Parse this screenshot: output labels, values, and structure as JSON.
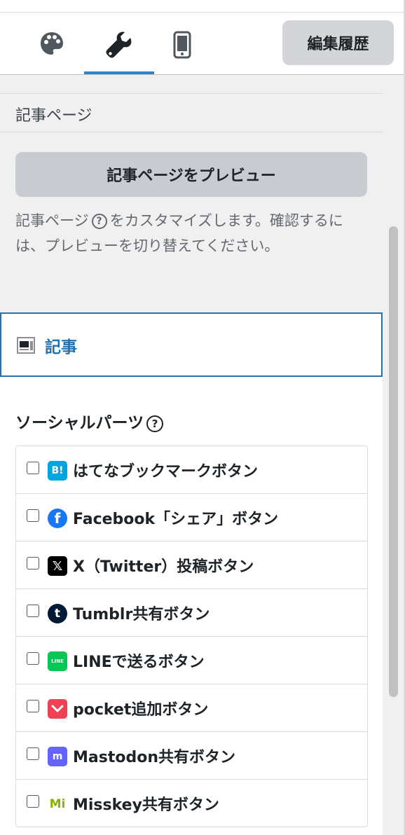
{
  "toolbar": {
    "tabs": [
      {
        "icon": "palette-icon"
      },
      {
        "icon": "wrench-icon",
        "active": true
      },
      {
        "icon": "smartphone-icon"
      }
    ],
    "history_label": "編集履歴"
  },
  "section": {
    "title": "記事ページ",
    "preview_label": "記事ページをプレビュー",
    "desc_before": "記事ページ",
    "desc_after": "をカスタマイズします。確認するには、プレビューを切り替えてください。",
    "help_glyph": "?"
  },
  "article": {
    "label": "記事"
  },
  "social": {
    "title": "ソーシャルパーツ",
    "help_glyph": "?",
    "items": [
      {
        "label": "はてなブックマークボタン",
        "icon": "hatena-bookmark-icon",
        "icon_text": "B!",
        "color": "#00a4de"
      },
      {
        "label": "Facebook「シェア」ボタン",
        "icon": "facebook-icon",
        "icon_text": "f",
        "color": "#1877f2"
      },
      {
        "label": "X（Twitter）投稿ボタン",
        "icon": "x-icon",
        "icon_text": "𝕏",
        "color": "#000000"
      },
      {
        "label": "Tumblr共有ボタン",
        "icon": "tumblr-icon",
        "icon_text": "t",
        "color": "#001935"
      },
      {
        "label": "LINEで送るボタン",
        "icon": "line-icon",
        "icon_text": "LINE",
        "color": "#06c755"
      },
      {
        "label": "pocket追加ボタン",
        "icon": "pocket-icon",
        "icon_text": "",
        "color": "#ef4056"
      },
      {
        "label": "Mastodon共有ボタン",
        "icon": "mastodon-icon",
        "icon_text": "m",
        "color": "#6364ff"
      },
      {
        "label": "Misskey共有ボタン",
        "icon": "misskey-icon",
        "icon_text": "Mi",
        "color": "#86b300"
      }
    ]
  }
}
